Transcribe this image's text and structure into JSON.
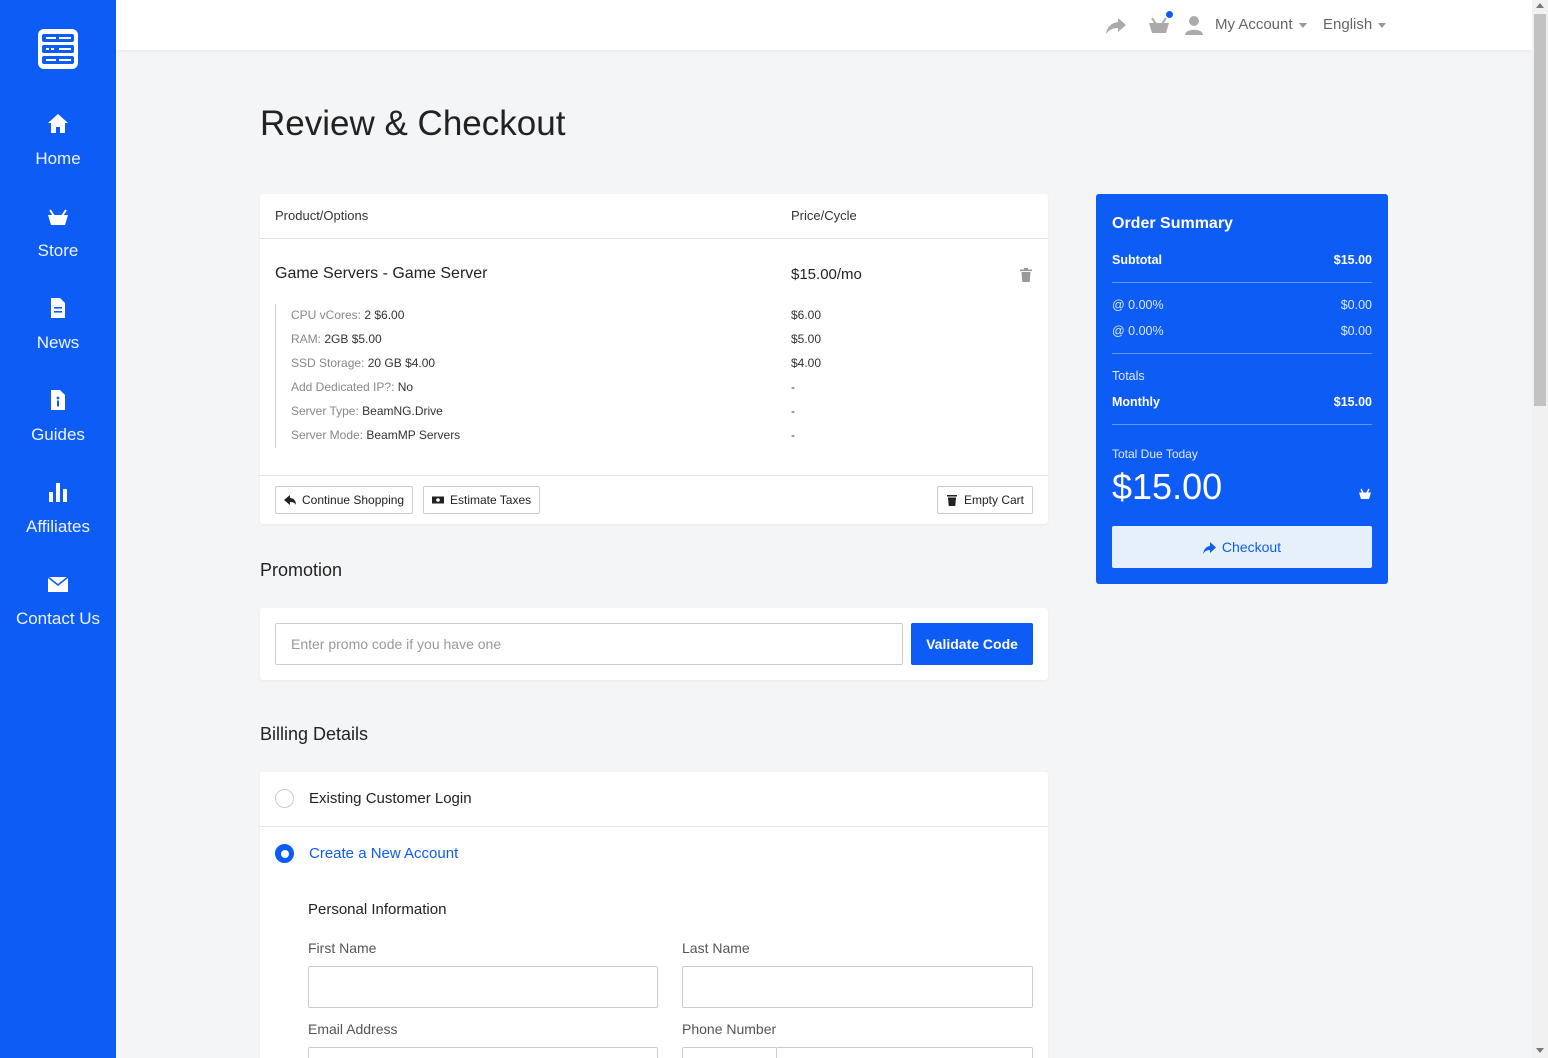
{
  "sidebar": {
    "logo": "server-rack-logo",
    "items": [
      {
        "label": "Home",
        "icon": "home-icon"
      },
      {
        "label": "Store",
        "icon": "basket-icon"
      },
      {
        "label": "News",
        "icon": "document-icon"
      },
      {
        "label": "Guides",
        "icon": "info-file-icon"
      },
      {
        "label": "Affiliates",
        "icon": "bar-chart-icon"
      },
      {
        "label": "Contact Us",
        "icon": "envelope-icon"
      }
    ]
  },
  "topbar": {
    "account_label": "My Account",
    "language_label": "English"
  },
  "page": {
    "title": "Review & Checkout"
  },
  "cart": {
    "col_product": "Product/Options",
    "col_price": "Price/Cycle",
    "product_name": "Game Servers - Game Server",
    "product_price": "$15.00/mo",
    "options": [
      {
        "key": "CPU vCores:",
        "value": "2 $6.00",
        "price": "$6.00"
      },
      {
        "key": "RAM:",
        "value": "2GB $5.00",
        "price": "$5.00"
      },
      {
        "key": "SSD Storage:",
        "value": "20 GB $4.00",
        "price": "$4.00"
      },
      {
        "key": "Add Dedicated IP?:",
        "value": "No",
        "price": "-"
      },
      {
        "key": "Server Type:",
        "value": "BeamNG.Drive",
        "price": "-"
      },
      {
        "key": "Server Mode:",
        "value": "BeamMP Servers",
        "price": "-"
      }
    ],
    "continue_label": "Continue Shopping",
    "estimate_label": "Estimate Taxes",
    "empty_label": "Empty Cart"
  },
  "promotion": {
    "title": "Promotion",
    "placeholder": "Enter promo code if you have one",
    "button": "Validate Code"
  },
  "billing": {
    "title": "Billing Details",
    "existing_label": "Existing Customer Login",
    "new_label": "Create a New Account",
    "personal_title": "Personal Information",
    "first_name": "First Name",
    "last_name": "Last Name",
    "email": "Email Address",
    "phone": "Phone Number"
  },
  "summary": {
    "title": "Order Summary",
    "subtotal_label": "Subtotal",
    "subtotal_value": "$15.00",
    "tax1_label": "@ 0.00%",
    "tax1_value": "$0.00",
    "tax2_label": "@ 0.00%",
    "tax2_value": "$0.00",
    "totals_label": "Totals",
    "monthly_label": "Monthly",
    "monthly_value": "$15.00",
    "due_label": "Total Due Today",
    "due_amount": "$15.00",
    "checkout_label": "Checkout"
  },
  "colors": {
    "brand": "#0d5cf5",
    "background": "#f4f5f7"
  }
}
